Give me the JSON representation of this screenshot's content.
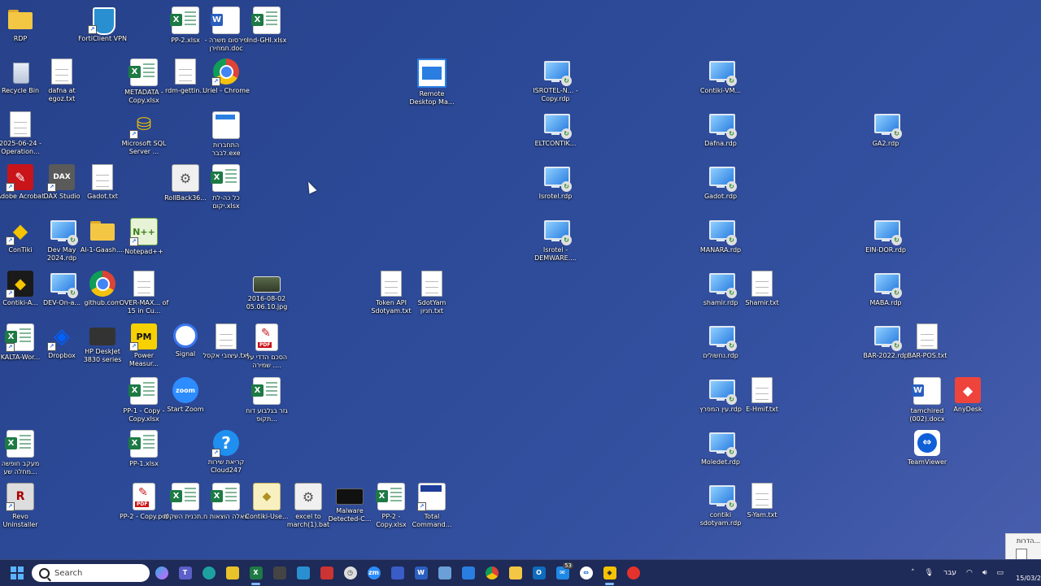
{
  "desktop": {
    "icons": {
      "rdp_folder": "RDP",
      "forticlient": "FortiClient VPN",
      "pp2_xlsx": "PP-2.xlsx",
      "word_doc": "פירסום משרה - תמחירן.doc",
      "ind_ghi": "Ind-GHI.xlsx",
      "recycle_bin": "Recycle Bin",
      "dafna_txt": "dafna at egoz.txt",
      "metadata": "METADATA - Copy.xlsx",
      "rdm": "rdm-gettin...",
      "uriel_chrome": "Uriel - Chrome",
      "remote_desktop": "Remote Desktop Ma...",
      "isrotel_copy": "ISROTEL-N... - Copy.rdp",
      "contiki_vm": "Contiki-VM...",
      "operation_txt": "2025-06-24 - Operation...",
      "sql_server": "Microsoft SQL Server ...",
      "hitchabrut": "התחברות לבבר.exe",
      "eltcontik": "ELTCONTIK...",
      "dafna_rdp": "Dafna.rdp",
      "ga2_rdp": "GA2.rdp",
      "adobe": "Adobe Acrobat",
      "dax": "DAX Studio",
      "gadot_txt": "Gadot.txt",
      "rollback": "RollBack36...",
      "kol_ha": "כל כה-לת יקום.xlsx",
      "isrotel_rdp": "Isrotel.rdp",
      "gadot_rdp": "Gadot.rdp",
      "contiki": "ConTiki",
      "devmay": "Dev May 2024.rdp",
      "al_gaash": "Al-1-Gaash....",
      "notepad": "Notepad++",
      "isrotel_demware": "Isrotel - DEMWARE....",
      "manara": "MANARA.rdp",
      "eindor": "EIN-DOR.rdp",
      "contiki_a": "Contiki-A...",
      "devon": "DEV-On-a...",
      "github": "github.com",
      "overmax": "OVER-MAX... of 15 in Cu...",
      "jpg_2016": "2016-08-02 05.06.10.jpg",
      "token_api": "Token API Sdotyam.txt",
      "sdotyam": "SdotYam חניון.txt",
      "shamir_rdp": "shamir.rdp",
      "shamir_txt": "Shamir.txt",
      "maba": "MABA.rdp",
      "kalta": "KALTA-Wor...",
      "dropbox": "Dropbox",
      "hp": "HP DeskJet 3830 series",
      "power": "Power Measur...",
      "signal": "Signal",
      "itzuv": "עיצובי אקסל.txt",
      "haskem": "הסכם הדדי על שמירה ....",
      "nishulim": "נחשולים.rdp",
      "bar2022": "BAR-2022.rdp",
      "barpos": "BAR-POS.txt",
      "pp1_copy": "PP-1 - Copy - Copy.xlsx",
      "zoom": "Start Zoom",
      "gizar": "גזר בגלבוע דוח תקופ...",
      "ein_hamefarats": "עין המפרץ.rdp",
      "ehmif": "E-Hmif.txt",
      "tamchired": "tamchired (002).docx",
      "anydesk": "AnyDesk",
      "maakav": "מעקב חופשה מחלה שע...",
      "pp1_xlsx": "PP-1.xlsx",
      "kriat": "קריאת שירות Cloud247",
      "moledet": "Moledet.rdp",
      "teamviewer": "TeamViewer",
      "revo": "Revo Uninstaller",
      "pp2_pdf": "PP-2 - Copy.pdf",
      "tochnit": "תכנית השקעו...",
      "sheela": "שאלה הוצאות ח",
      "contiki_use": "Contiki-Use...",
      "excel_to_march": "excel to march(1).bat",
      "malware": "Malware Detected-C...",
      "pp2_copy": "PP-2 - Copy.xlsx",
      "total_cmd": "Total Command...",
      "contiki_sdotyam": "contiki sdotyam.rdp",
      "syam": "S-Yam.txt"
    }
  },
  "notification": {
    "title": "הדרות..."
  },
  "taskbar": {
    "search_placeholder": "Search",
    "badge_count": "53",
    "language": "עבר",
    "date": "15/03/2"
  },
  "colors": {
    "accent": "#5ab4ff",
    "taskbar": "#1e2a57",
    "excel": "#1d7a45"
  }
}
